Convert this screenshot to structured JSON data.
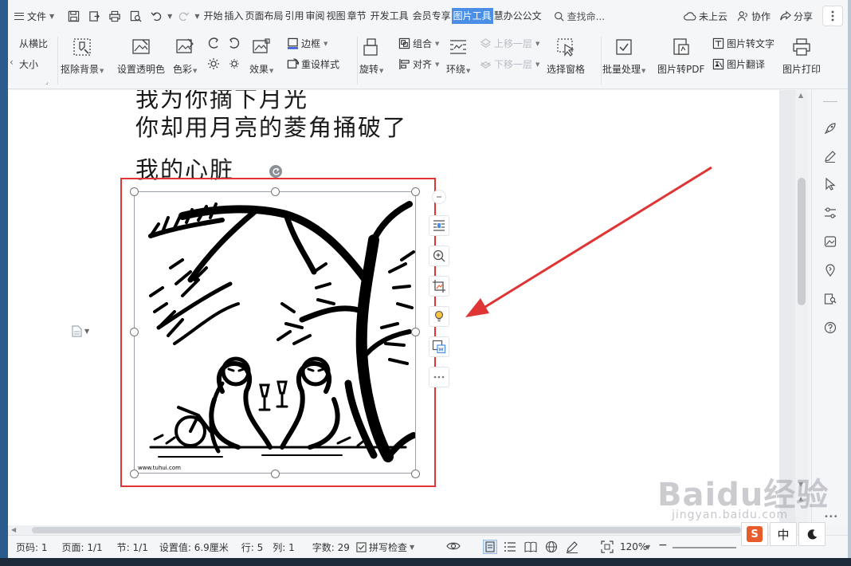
{
  "menubar": {
    "file_label": "文件",
    "tabs": [
      {
        "label": "开始",
        "active": false
      },
      {
        "label": "插入",
        "active": false
      },
      {
        "label": "页面布局",
        "active": false
      },
      {
        "label": "引用",
        "active": false
      },
      {
        "label": "审阅",
        "active": false
      },
      {
        "label": "视图",
        "active": false
      },
      {
        "label": "章节",
        "active": false
      },
      {
        "label": "开发工具",
        "active": false
      },
      {
        "label": "会员专享",
        "active": false
      },
      {
        "label": "图片工具",
        "active": true
      },
      {
        "label": "慧办公公文",
        "active": false
      }
    ],
    "search_label": "查找命...",
    "cloud_label": "未上云",
    "collab_label": "协作",
    "share_label": "分享"
  },
  "ribbon": {
    "lock_ratio": "从横比",
    "size": "大小",
    "remove_bg": "抠除背景",
    "set_transparent": "设置透明色",
    "color": "色彩",
    "effects": "效果",
    "border": "边框",
    "reset_style": "重设样式",
    "rotate": "旋转",
    "group": "组合",
    "align": "对齐",
    "wrap": "环绕",
    "bring_forward": "上移一层",
    "send_backward": "下移一层",
    "selection_pane": "选择窗格",
    "batch_process": "批量处理",
    "to_pdf": "图片转PDF",
    "to_text": "图片转文字",
    "translate": "图片翻译",
    "print": "图片打印"
  },
  "document": {
    "lines": [
      "我为你摘下月光",
      "你却用月亮的菱角捅破了",
      "我的心脏"
    ]
  },
  "statusbar": {
    "page_no": "页码: 1",
    "pages": "页面: 1/1",
    "section": "节: 1/1",
    "setting": "设置值: 6.9厘米",
    "row": "行: 5",
    "col": "列: 1",
    "word_count": "字数: 29",
    "spell_check": "拼写检查",
    "zoom": "120%"
  },
  "ime": {
    "lang": "中"
  },
  "image": {
    "credit": "www.tuhui.com"
  },
  "watermark": {
    "main": "Baidu经验",
    "sub": "jingyan.baidu.com"
  },
  "colors": {
    "accent": "#4a8fe5",
    "annotation_red": "#e03535"
  }
}
